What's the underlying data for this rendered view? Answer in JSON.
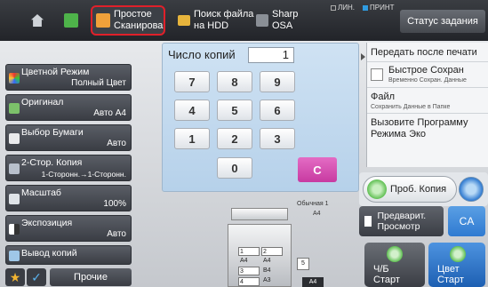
{
  "top_bar": {
    "simple_scan": "Простое Сканировани",
    "hdd_search": "Поиск файла на HDD",
    "sharp_osa": "Sharp OSA",
    "line_indicator": "ЛИН.",
    "print_indicator": "ПРИНТ",
    "job_status": "Статус задания"
  },
  "left_menu": [
    {
      "label": "Цветной Режим",
      "value": "Полный Цвет",
      "icon": "color-mode-icon"
    },
    {
      "label": "Оригинал",
      "value": "Авто  A4",
      "icon": "original-icon"
    },
    {
      "label": "Выбор Бумаги",
      "value": "Авто",
      "icon": "paper-select-icon"
    },
    {
      "label": "2-Стор. Копия",
      "value": "1-Сторонн.→1-Сторонн.",
      "icon": "duplex-icon"
    },
    {
      "label": "Масштаб",
      "value": "100%",
      "icon": "zoom-icon"
    },
    {
      "label": "Экспозиция",
      "value": "Авто",
      "icon": "exposure-icon"
    },
    {
      "label": "Вывод копий",
      "value": "",
      "icon": "output-icon"
    }
  ],
  "bottom_left": {
    "others": "Прочие"
  },
  "keypad": {
    "title": "Число копий",
    "value": "1",
    "keys": [
      "7",
      "8",
      "9",
      "4",
      "5",
      "6",
      "1",
      "2",
      "3",
      "0"
    ],
    "clear": "C"
  },
  "right_panel": {
    "send_after_print": "Передать после печати",
    "quick_save": "Быстрое Сохран",
    "quick_save_sub": "Временно Сохран. Данные",
    "file": "Файл",
    "file_sub": "Сохранить Данные в Папке",
    "eco": "Вызовите Программу Режима Эко"
  },
  "preview": {
    "paper_label": "Обычная 1",
    "paper_size": "A4",
    "trays": [
      {
        "num": "1",
        "size": "A4"
      },
      {
        "num": "2",
        "size": "A4"
      },
      {
        "num": "3",
        "size": "B4"
      },
      {
        "num": "4",
        "size": "A3"
      },
      {
        "num": "5",
        "size": ""
      }
    ],
    "output_size": "A4"
  },
  "actions": {
    "proof_copy": "Проб. Копия",
    "preview": "Предварит. Просмотр",
    "ca": "CA",
    "bw_start": "Ч/Б Старт",
    "color_start": "Цвет Старт"
  },
  "colors": {
    "accent_blue": "#2f7ad1",
    "clear_pink": "#d94fb4",
    "highlight_red": "#e0202a",
    "ca_blue": "#3b86d8"
  }
}
